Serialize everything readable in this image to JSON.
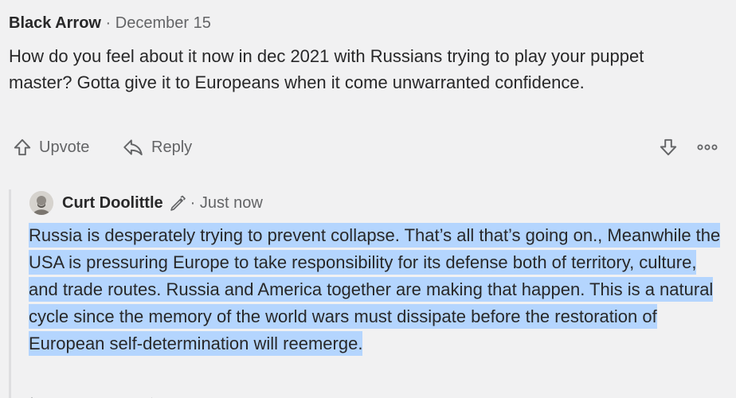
{
  "comment": {
    "author": "Black Arrow",
    "separator": "·",
    "date": "December 15",
    "text": "How do you feel about it now in dec 2021 with Russians trying to play your puppet master? Gotta give it to Europeans when it come unwarranted confidence.",
    "actions": {
      "upvote_label": "Upvote",
      "reply_label": "Reply",
      "upvote_icon": "arrow-up-icon",
      "reply_icon": "reply-arrow-icon",
      "downvote_icon": "arrow-down-icon",
      "more_icon": "more-dots-icon"
    }
  },
  "reply": {
    "author": "Curt Doolittle",
    "author_badge_icon": "pencil-icon",
    "meta": "· Just now",
    "text": "Russia is desperately trying to prevent collapse. That’s all that’s going on., Meanwhile the USA is pressuring Europe to take responsibility for its defense both of territory, culture, and trade routes. Russia and America together are making that happen. This is a natural cycle since the memory of the world wars must dissipate before the restoration of European self-determination will reemerge.",
    "text_selected": true
  },
  "colors": {
    "background": "#f1f1f2",
    "text_primary": "#282829",
    "text_secondary": "#636466",
    "selection_highlight": "#b4d5fe",
    "thread_line": "#dedee0"
  }
}
